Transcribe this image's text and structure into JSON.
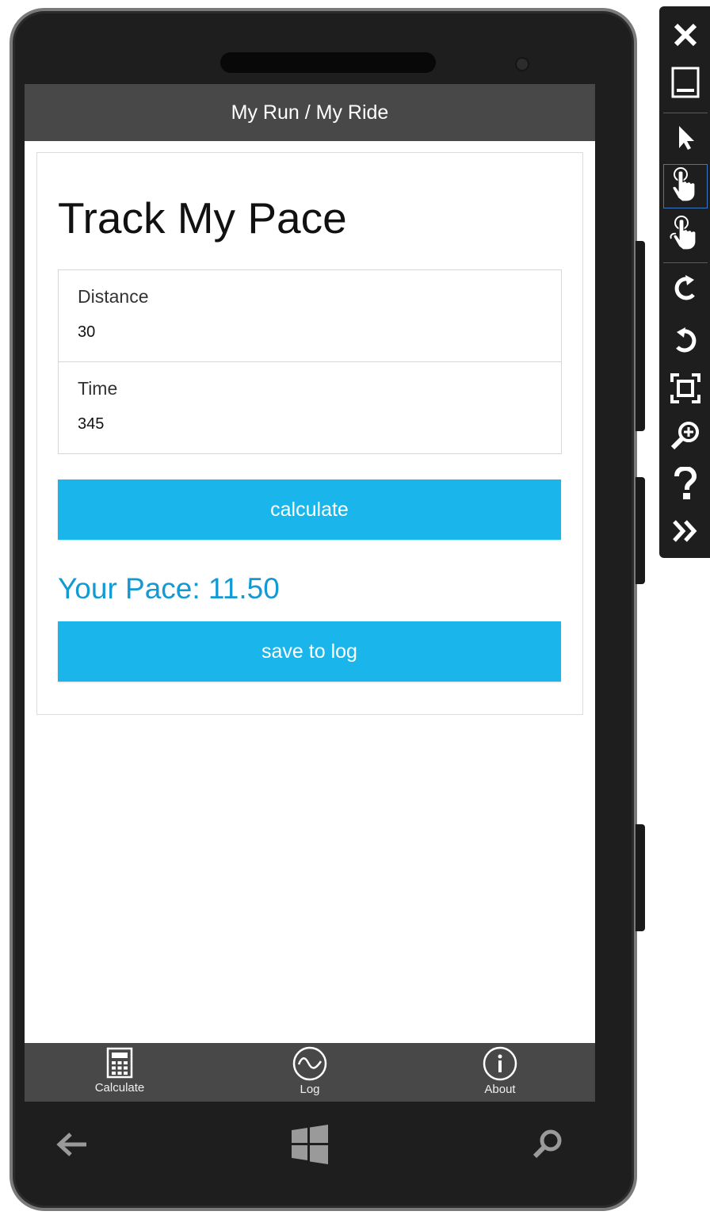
{
  "app": {
    "title": "My Run / My Ride",
    "heading": "Track My Pace"
  },
  "form": {
    "distance": {
      "label": "Distance",
      "value": "30"
    },
    "time": {
      "label": "Time",
      "value": "345"
    }
  },
  "buttons": {
    "calculate": "calculate",
    "save": "save to log"
  },
  "result": {
    "pace_text": "Your Pace: 11.50"
  },
  "appbar": {
    "items": [
      {
        "label": "Calculate",
        "icon": "calculator-icon"
      },
      {
        "label": "Log",
        "icon": "log-wave-icon"
      },
      {
        "label": "About",
        "icon": "info-icon"
      }
    ]
  },
  "hardware_nav": {
    "icons": [
      "back-arrow-icon",
      "windows-start-icon",
      "search-icon"
    ]
  },
  "emulator_toolbar": {
    "icons": [
      "close-icon",
      "minimize-icon",
      "pointer-icon",
      "single-touch-icon",
      "multi-touch-icon",
      "rotate-left-icon",
      "rotate-right-icon",
      "fit-to-screen-icon",
      "zoom-icon",
      "help-icon",
      "additional-tools-icon"
    ],
    "selected": "single-touch-icon"
  },
  "colors": {
    "accent": "#1ab6eb",
    "pace_text": "#139ad4",
    "titlebar": "#484848",
    "phone_body": "#1e1e1e"
  }
}
